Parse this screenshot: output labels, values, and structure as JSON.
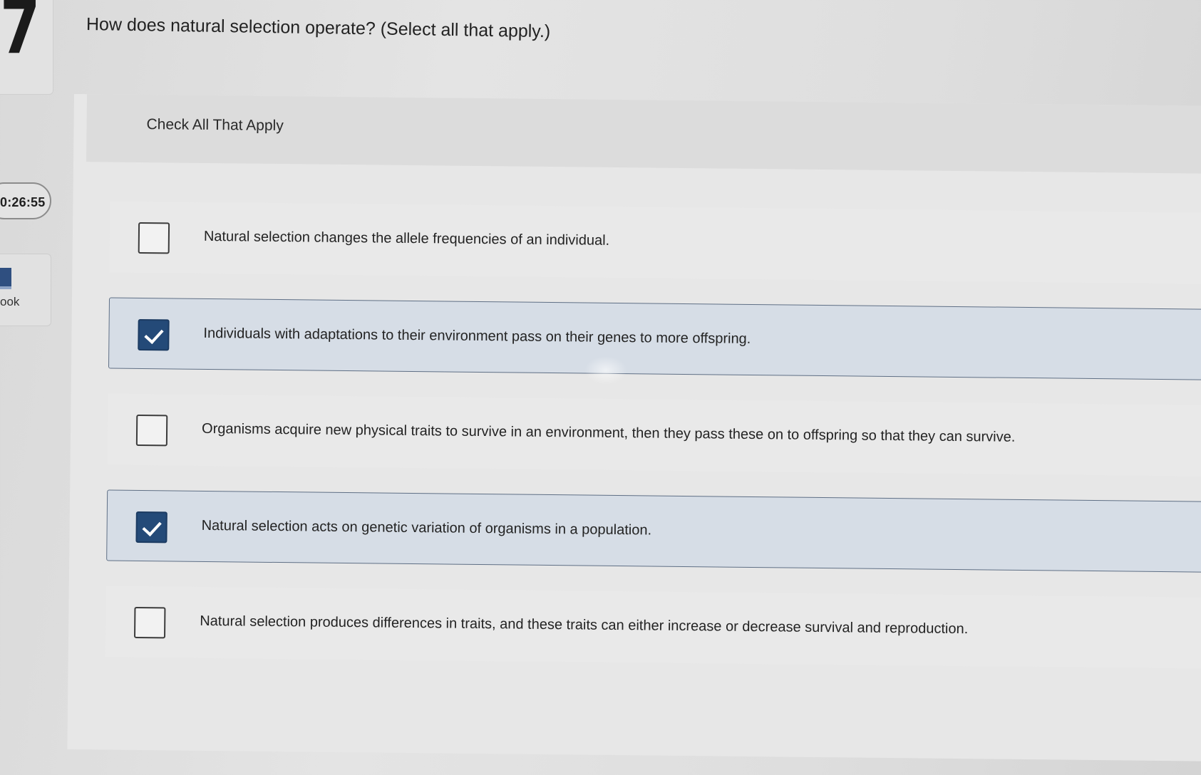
{
  "rail": {
    "question_number": "7",
    "timer": "0:26:55",
    "ebook_label": "ook"
  },
  "question": {
    "text": "How does natural selection operate? (Select all that apply.)"
  },
  "panel": {
    "title": "Check All That Apply",
    "options": [
      {
        "label": "Natural selection changes the allele frequencies of an individual.",
        "checked": false
      },
      {
        "label": "Individuals with adaptations to their environment pass on their genes to more offspring.",
        "checked": true
      },
      {
        "label": "Organisms acquire new physical traits to survive in an environment, then they pass these on to offspring so that they can survive.",
        "checked": false
      },
      {
        "label": "Natural selection acts on genetic variation of organisms in a population.",
        "checked": true
      },
      {
        "label": "Natural selection produces differences in traits, and these traits can either increase or decrease survival and reproduction.",
        "checked": false
      }
    ]
  },
  "colors": {
    "selected_fill": "#d6dde6",
    "checkbox_checked": "#244a78"
  }
}
